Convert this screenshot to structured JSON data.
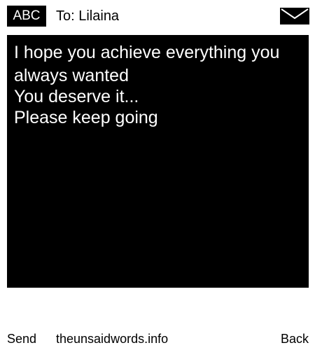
{
  "header": {
    "input_mode": "ABC",
    "recipient": "To: Lilaina",
    "envelope_icon": "envelope-icon"
  },
  "message": {
    "lines": [
      "I hope you achieve everything you",
      "always wanted",
      "You deserve it...",
      "Please keep going"
    ]
  },
  "footer": {
    "left_softkey": "Send",
    "center_text": "theunsaidwords.info",
    "right_softkey": "Back"
  },
  "colors": {
    "background": "#ffffff",
    "message_background": "#000000",
    "message_text": "#ffffff",
    "text": "#000000"
  }
}
